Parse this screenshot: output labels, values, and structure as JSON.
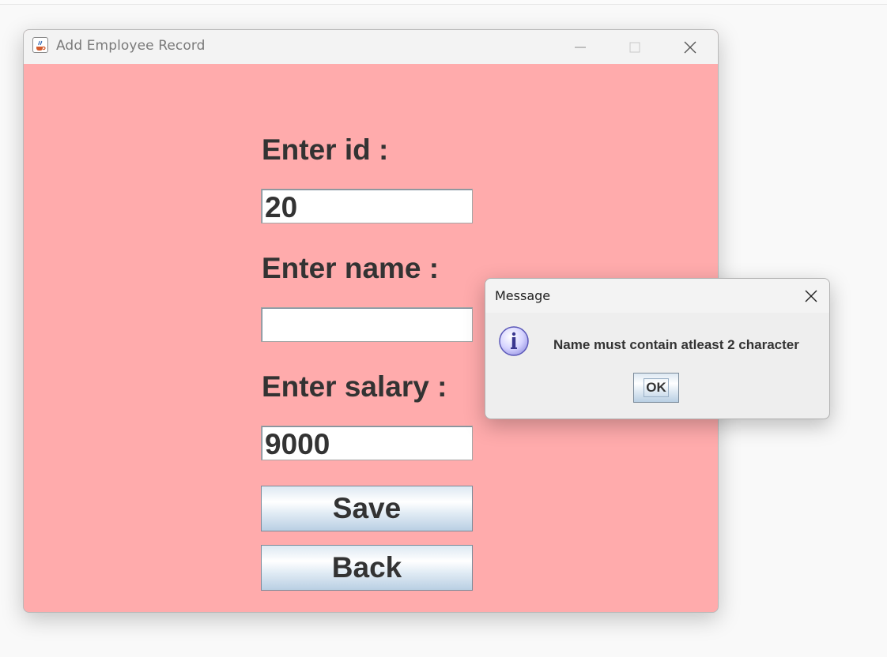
{
  "window": {
    "title": "Add Employee Record",
    "icon": "java-cup-icon",
    "controls": [
      "minimize-icon",
      "maximize-icon",
      "close-icon"
    ]
  },
  "form": {
    "id_label": "Enter id :",
    "id_value": "20",
    "name_label": "Enter name :",
    "name_value": "",
    "salary_label": "Enter salary :",
    "salary_value": "9000",
    "save_label": "Save",
    "back_label": "Back"
  },
  "dialog": {
    "title": "Message",
    "icon": "info-icon",
    "message": "Name must contain atleast 2 character",
    "ok_label": "OK"
  },
  "colors": {
    "content_background": "#ffabac",
    "text": "#333333"
  }
}
